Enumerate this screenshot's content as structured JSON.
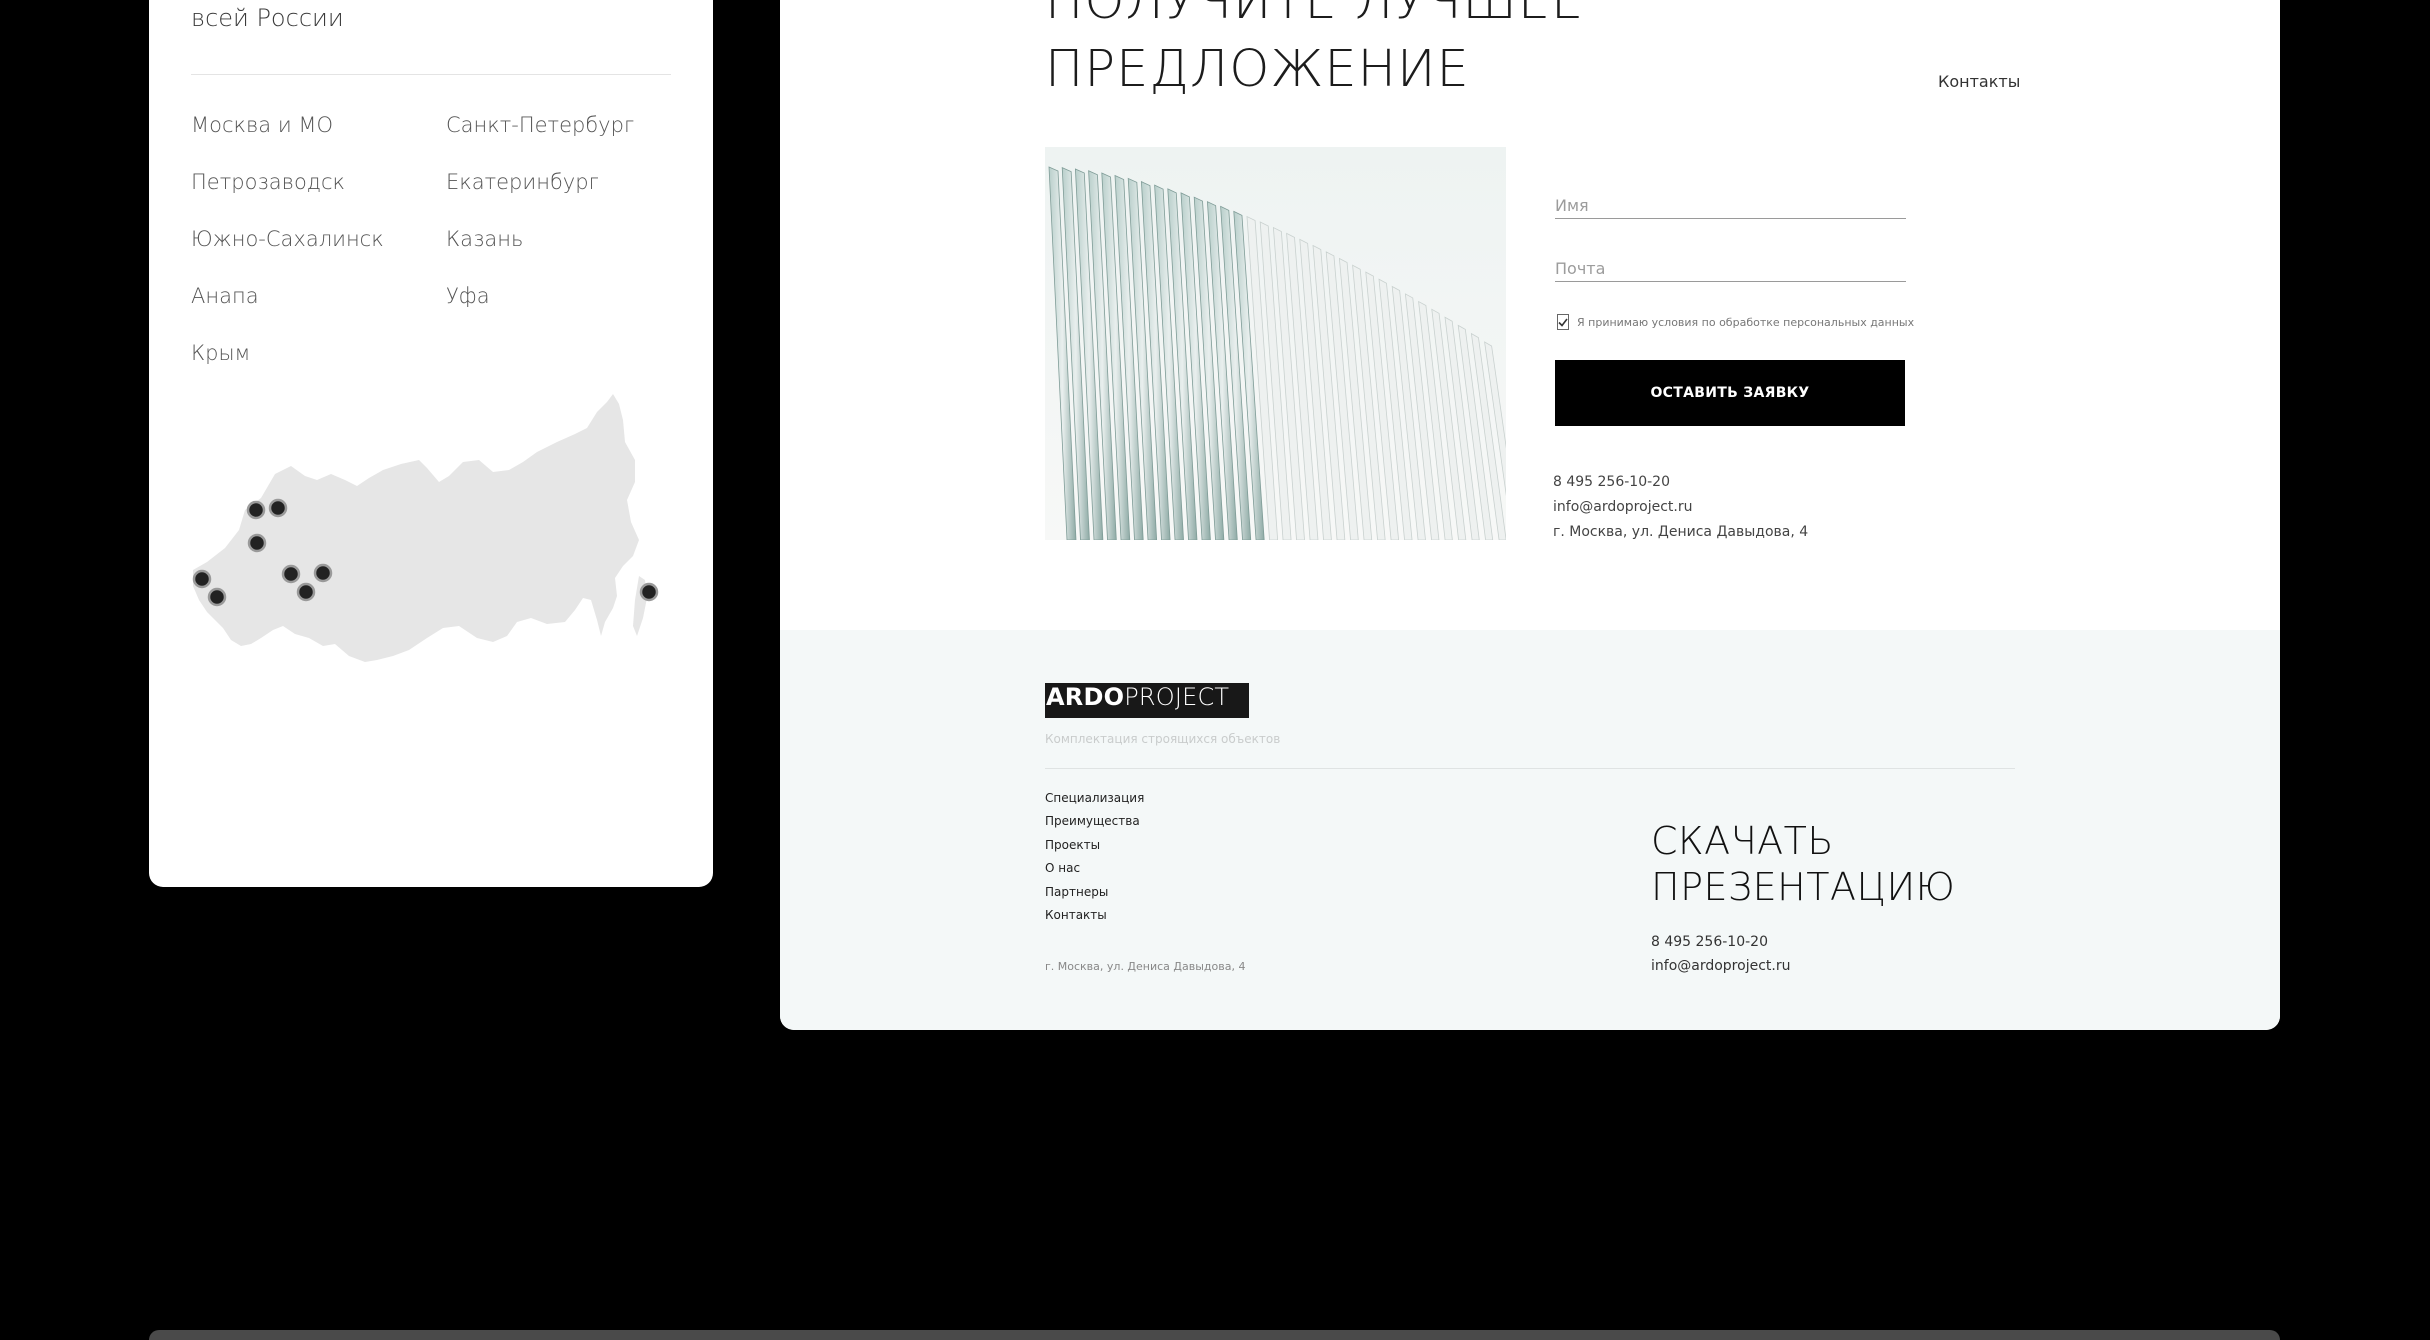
{
  "regions": {
    "heading_tail": "всей России",
    "cities": [
      "Москва и МО",
      "Санкт-Петербург",
      "Петрозаводск",
      "Екатеринбург",
      "Южно-Сахалинск",
      "Казань",
      "Анапа",
      "Уфа",
      "Крым"
    ]
  },
  "offer": {
    "title_line1": "ПОЛУЧИТЕ ЛУЧШЕЕ",
    "title_line2": "ПРЕДЛОЖЕНИЕ",
    "contacts_link": "Контакты",
    "form": {
      "name_placeholder": "Имя",
      "email_placeholder": "Почта",
      "consent_text": "Я принимаю условия по обработке персональных данных",
      "consent_checked": true,
      "submit_label": "ОСТАВИТЬ ЗАЯВКУ"
    },
    "phone": "8 495 256-10-20",
    "email": "info@ardoproject.ru",
    "address": "г. Москва, ул. Дениса Давыдова, 4"
  },
  "footer": {
    "logo_bold": "ARDO",
    "logo_light": "PROJECT",
    "tagline": "Комплектация строящихся объектов",
    "nav": [
      "Специализация",
      "Преимущества",
      "Проекты",
      "О нас",
      "Партнеры",
      "Контакты"
    ],
    "address": "г. Москва, ул. Дениса Давыдова, 4",
    "download_line1": "СКАЧАТЬ",
    "download_line2": "ПРЕЗЕНТАЦИЮ",
    "phone": "8 495 256-10-20",
    "email": "info@ardoproject.ru"
  },
  "colors": {
    "page_bg": "#000000",
    "card_bg": "#ffffff",
    "footer_bg": "#f4f8f8",
    "button_bg": "#000000",
    "map_fill": "#e8e8e8"
  }
}
